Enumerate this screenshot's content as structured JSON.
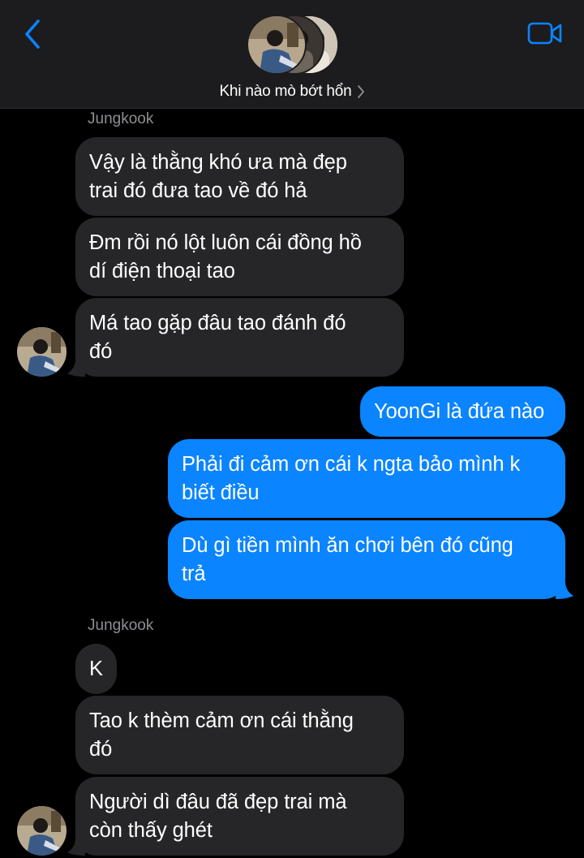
{
  "header": {
    "group_name": "Khi nào mò bớt hổn",
    "icons": {
      "back": "chevron-left-icon",
      "video": "video-camera-icon",
      "disclosure": "chevron-right-icon"
    },
    "accent_color": "#0a84ff"
  },
  "conversation": {
    "groups": [
      {
        "sender": "Jungkook",
        "direction": "incoming",
        "messages": [
          "Vậy là thằng khó ưa mà đẹp\ntrai đó đưa tao về đó hả",
          "Đm rồi nó lột luôn cái đồng hồ\ndí điện thoại tao",
          "Má tao gặp đâu tao đánh đó\nđó"
        ]
      },
      {
        "sender": "",
        "direction": "outgoing",
        "messages": [
          "YoonGi là đứa nào",
          "Phải đi cảm ơn cái k ngta bảo mình k\nbiết điều",
          "Dù gì tiền mình ăn chơi bên đó cũng\ntrả"
        ]
      },
      {
        "sender": "Jungkook",
        "direction": "incoming",
        "messages": [
          "K",
          "Tao k thèm cảm ơn cái thằng\nđó",
          "Người dì đâu đã đẹp trai mà\ncòn thấy ghét"
        ]
      }
    ]
  },
  "colors": {
    "incoming_bubble": "#262628",
    "outgoing_bubble": "#0a84ff",
    "background": "#000000",
    "header_background": "#1c1c1e",
    "sender_name": "#8e8e93"
  }
}
